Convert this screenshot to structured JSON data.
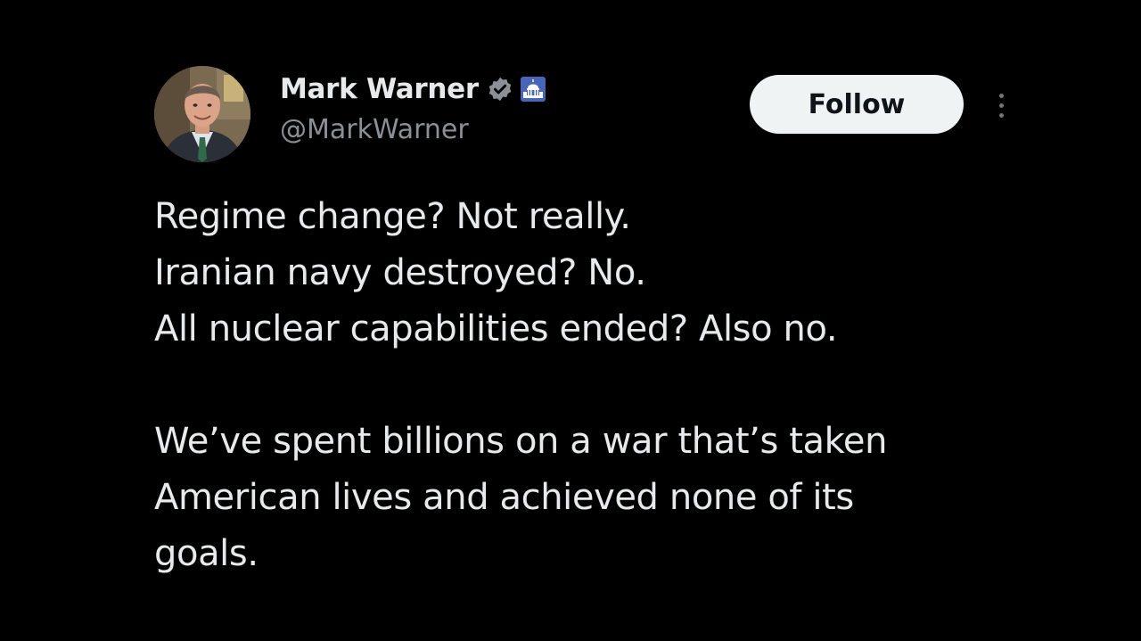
{
  "author": {
    "display_name": "Mark Warner",
    "handle": "@MarkWarner",
    "avatar_icon": "profile-photo",
    "verified_icon": "verified-badge-icon",
    "affiliation_icon": "capitol-building-icon"
  },
  "actions": {
    "follow_label": "Follow",
    "more_icon": "more-options-icon"
  },
  "tweet": {
    "paragraph_1": [
      "Regime change? Not really.",
      "Iranian navy destroyed? No.",
      "All nuclear capabilities ended? Also no."
    ],
    "paragraph_2": [
      "We’ve spent billions on a war that’s taken",
      "American lives and achieved none of its",
      "goals."
    ]
  },
  "colors": {
    "background": "#000000",
    "text": "#e7e9ea",
    "secondary_text": "#8b9096",
    "follow_bg": "#eff3f4",
    "verified_fill": "#8b9096"
  }
}
